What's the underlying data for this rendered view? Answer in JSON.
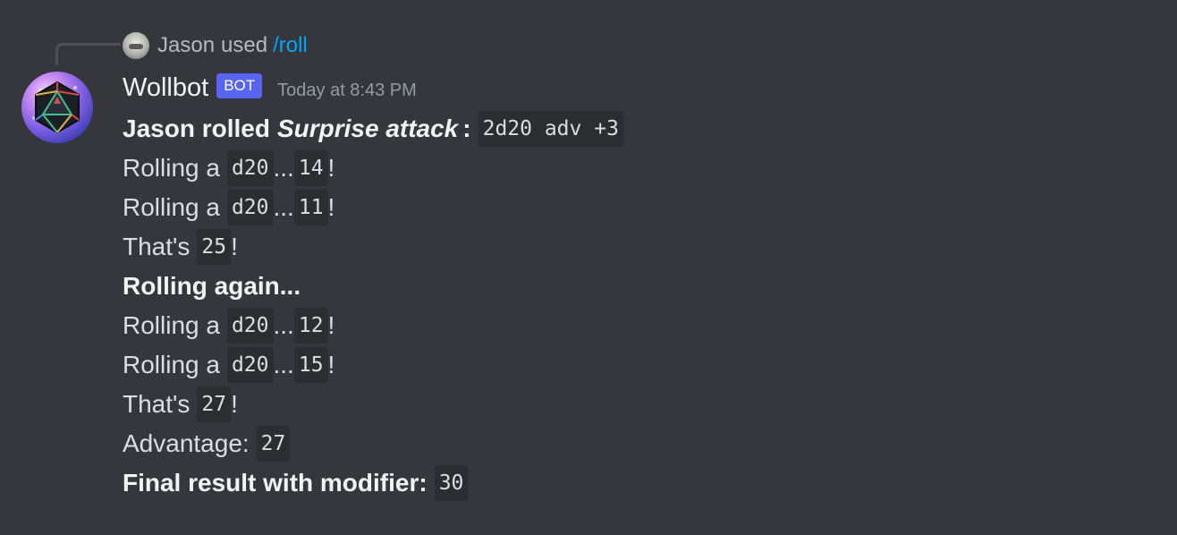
{
  "reply": {
    "user": "Jason",
    "used": "used",
    "command": "/roll"
  },
  "header": {
    "username": "Wollbot",
    "bot_tag": "BOT",
    "timestamp": "Today at 8:43 PM"
  },
  "message": {
    "intro_prefix": "Jason rolled",
    "roll_name": "Surprise attack",
    "intro_colon": ":",
    "roll_expression": "2d20 adv +3",
    "rolling_a": "Rolling a",
    "die": "d20",
    "ellipsis": "...",
    "bang": "!",
    "thats": "That's",
    "first_set": {
      "rolls": [
        "14",
        "11"
      ],
      "total": "25"
    },
    "rolling_again": "Rolling again...",
    "second_set": {
      "rolls": [
        "12",
        "15"
      ],
      "total": "27"
    },
    "advantage_label": "Advantage:",
    "advantage_value": "27",
    "final_label": "Final result with modifier:",
    "final_value": "30"
  },
  "colors": {
    "background": "#36373d",
    "code_background": "#2b2d31",
    "bot_tag": "#5865f2",
    "command_link": "#00a8fc",
    "timestamp": "#949ba4"
  }
}
